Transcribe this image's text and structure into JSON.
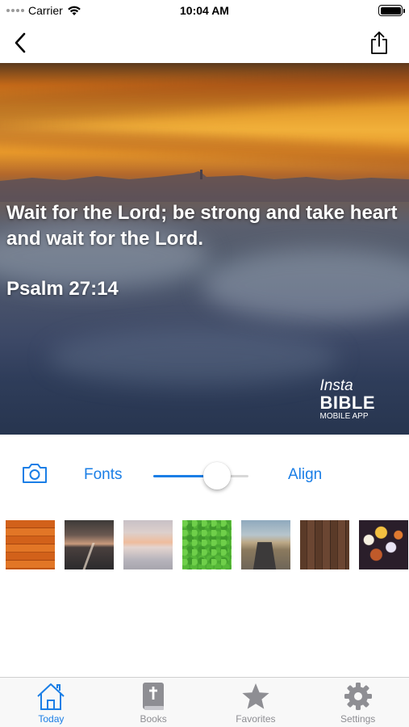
{
  "status_bar": {
    "carrier": "Carrier",
    "time": "10:04 AM"
  },
  "nav": {
    "back_icon": "chevron-left-icon",
    "share_icon": "share-icon"
  },
  "verse": {
    "text": "Wait for the Lord; be strong and take heart and wait for the Lord.",
    "reference": "Psalm 27:14"
  },
  "watermark": {
    "line1": "Insta",
    "line2": "BIBLE",
    "line3": "MOBILE APP"
  },
  "controls": {
    "camera_icon": "camera-icon",
    "fonts_label": "Fonts",
    "slider_value": 0.67,
    "align_label": "Align"
  },
  "backgrounds": [
    {
      "name": "orange-wood"
    },
    {
      "name": "dusk-road"
    },
    {
      "name": "sunset-haze"
    },
    {
      "name": "green-grass"
    },
    {
      "name": "desert-road"
    },
    {
      "name": "dark-wood"
    },
    {
      "name": "bokeh-lights"
    }
  ],
  "tabs": [
    {
      "label": "Today",
      "icon": "home-icon",
      "active": true
    },
    {
      "label": "Books",
      "icon": "bible-icon",
      "active": false
    },
    {
      "label": "Favorites",
      "icon": "star-icon",
      "active": false
    },
    {
      "label": "Settings",
      "icon": "gear-icon",
      "active": false
    }
  ],
  "colors": {
    "accent": "#1a7ee6",
    "inactive_tab": "#8e8e93"
  }
}
